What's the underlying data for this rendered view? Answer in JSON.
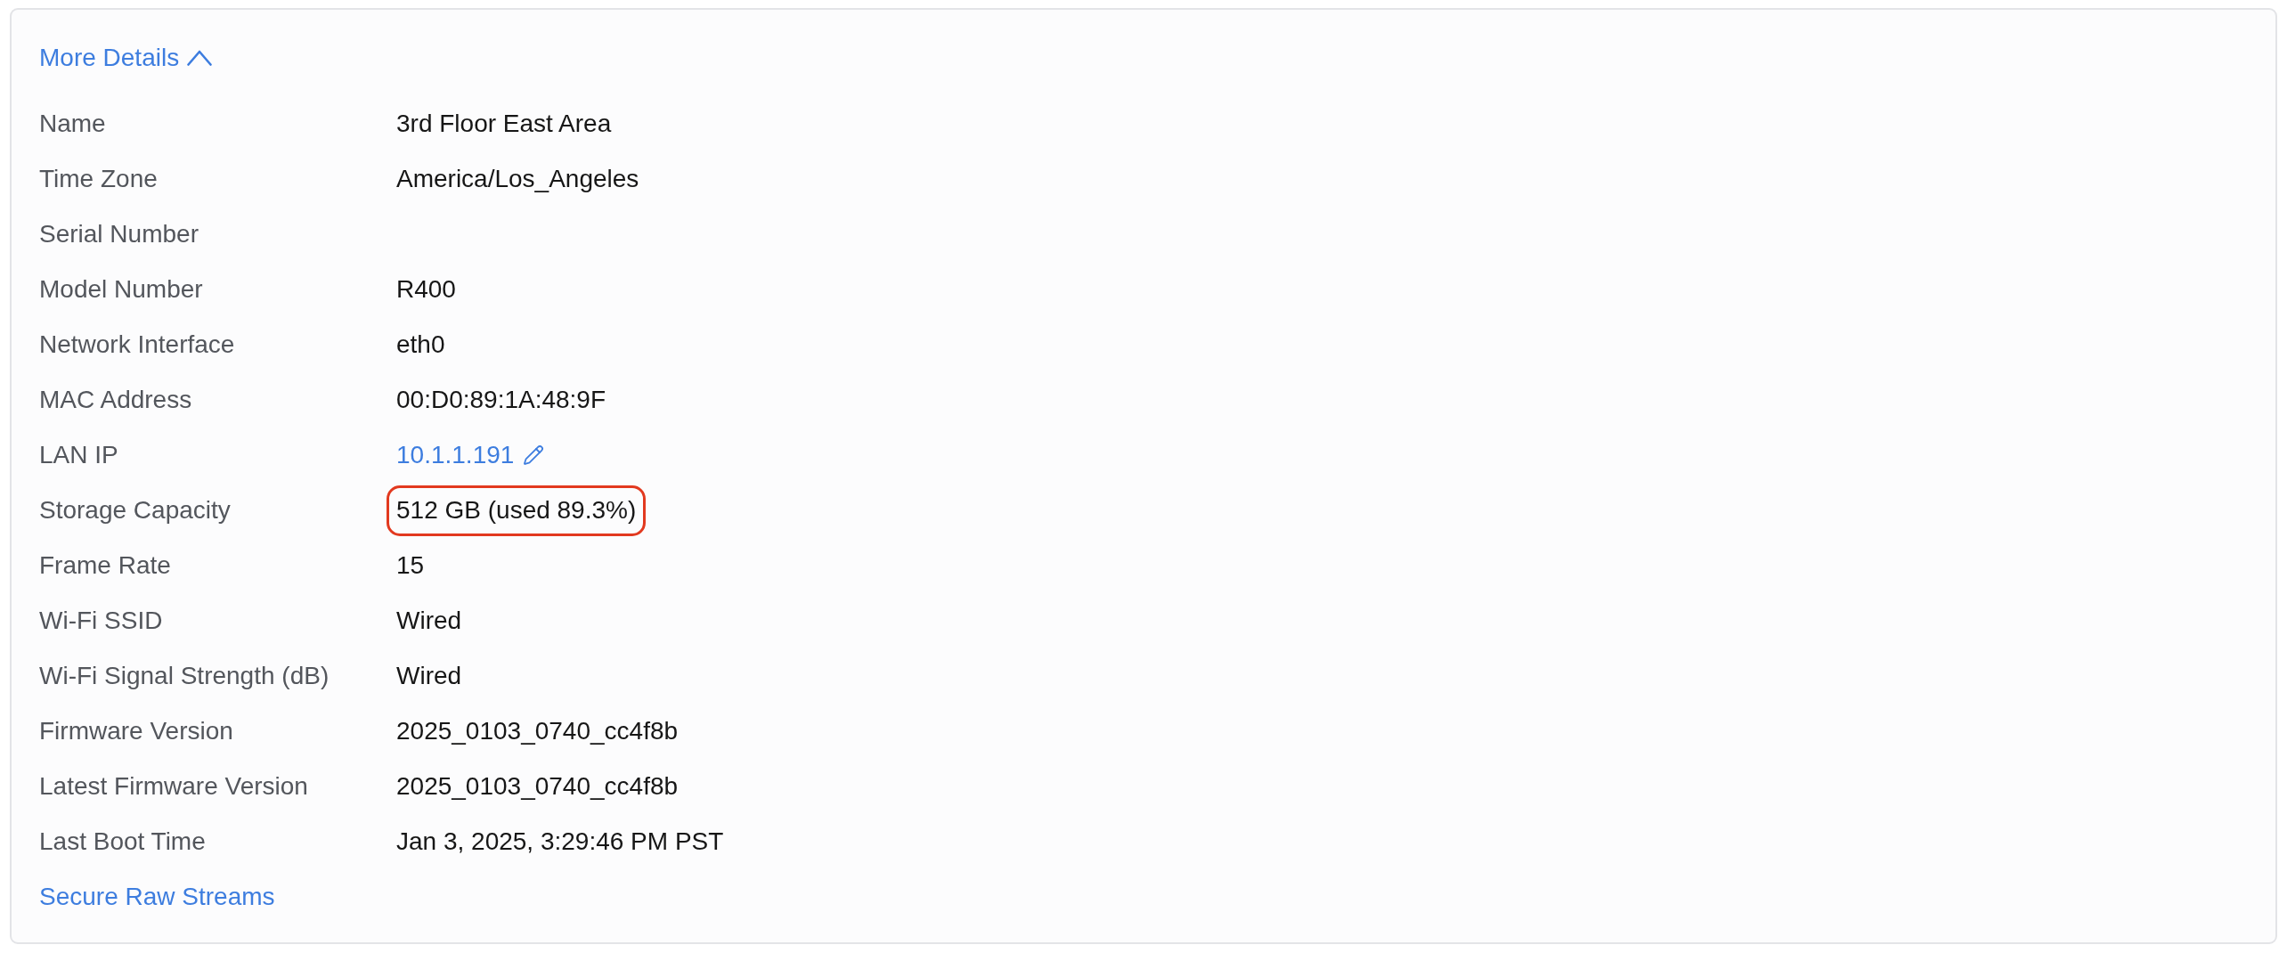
{
  "details_toggle": {
    "label": "More Details",
    "expanded": true
  },
  "fields": [
    {
      "kind": "text",
      "label": "Name",
      "value": "3rd Floor East Area"
    },
    {
      "kind": "text",
      "label": "Time Zone",
      "value": "America/Los_Angeles"
    },
    {
      "kind": "blank",
      "label": "Serial Number"
    },
    {
      "kind": "text",
      "label": "Model Number",
      "value": "R400"
    },
    {
      "kind": "text",
      "label": "Network Interface",
      "value": "eth0"
    },
    {
      "kind": "text",
      "label": "MAC Address",
      "value": "00:D0:89:1A:48:9F"
    },
    {
      "kind": "editable_link",
      "label": "LAN IP",
      "value": "10.1.1.191"
    },
    {
      "kind": "circled",
      "label": "Storage Capacity",
      "value": "512 GB (used 89.3%)"
    },
    {
      "kind": "text",
      "label": "Frame Rate",
      "value": "15"
    },
    {
      "kind": "text",
      "label": "Wi-Fi SSID",
      "value": "Wired"
    },
    {
      "kind": "text",
      "label": "Wi-Fi Signal Strength (dB)",
      "value": "Wired"
    },
    {
      "kind": "text",
      "label": "Firmware Version",
      "value": "2025_0103_0740_cc4f8b"
    },
    {
      "kind": "text",
      "label": "Latest Firmware Version",
      "value": "2025_0103_0740_cc4f8b"
    },
    {
      "kind": "text",
      "label": "Last Boot Time",
      "value": "Jan 3, 2025, 3:29:46 PM PST"
    }
  ],
  "secure_streams_link": {
    "label": "Secure Raw Streams"
  }
}
